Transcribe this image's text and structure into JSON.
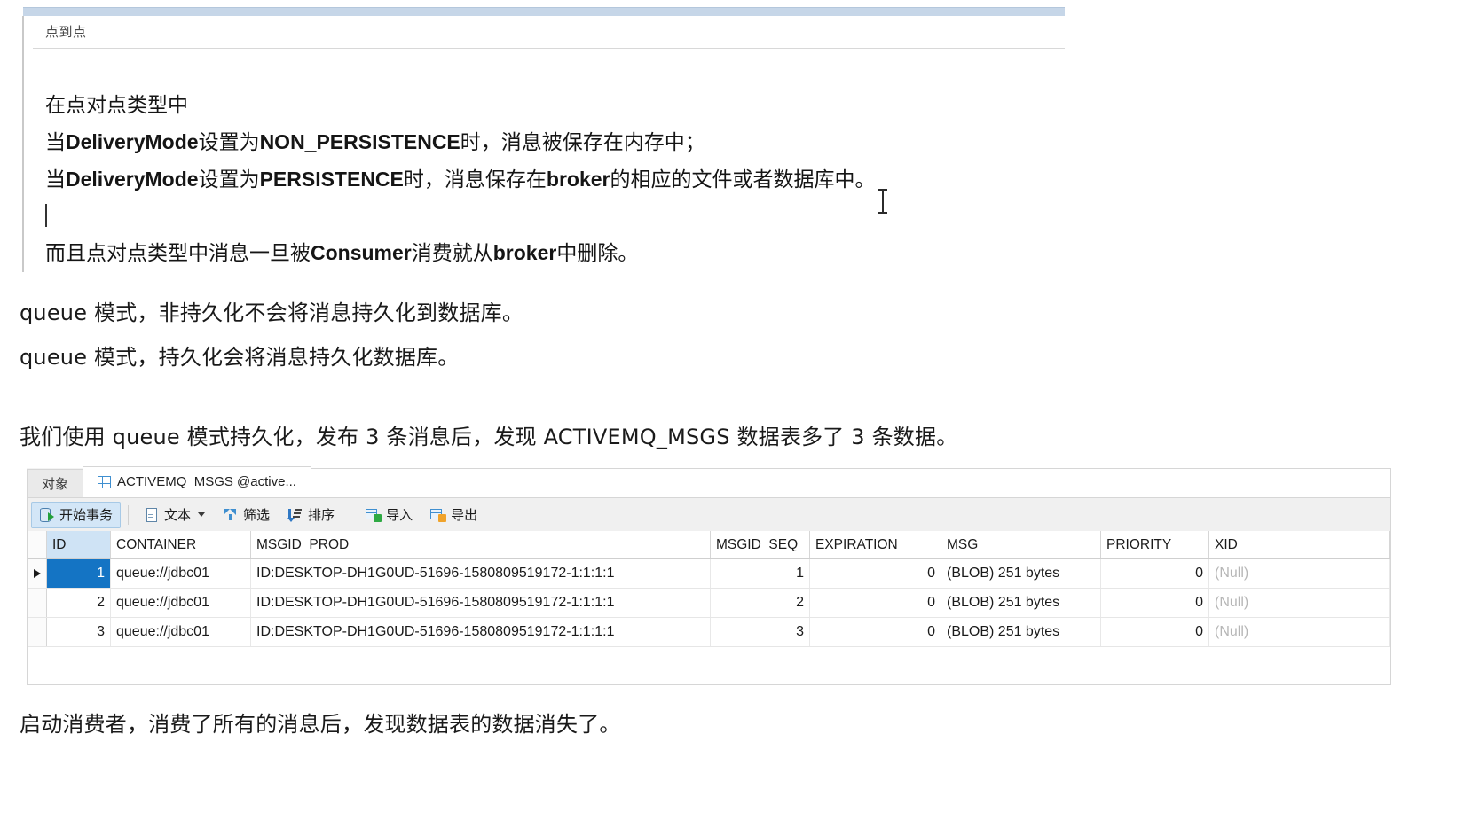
{
  "note": {
    "header_title": "点到点",
    "lines": [
      {
        "id": "l1",
        "text": "在点对点类型中"
      },
      {
        "id": "l2",
        "text": "当DeliveryMode设置为NON_PERSISTENCE时，消息被保存在内存中；"
      },
      {
        "id": "l3",
        "text": "当DeliveryMode设置为PERSISTENCE时，消息保存在broker的相应的文件或者数据库中。"
      },
      {
        "id": "l4",
        "text": ""
      },
      {
        "id": "l5",
        "text": "而且点对点类型中消息一旦被Consumer消费就从broker中删除。"
      }
    ]
  },
  "body": {
    "para1": "queue 模式，非持久化不会将消息持久化到数据库。",
    "para2": "queue 模式，持久化会将消息持久化数据库。",
    "para3": "我们使用 queue 模式持久化，发布 3 条消息后，发现 ACTIVEMQ_MSGS 数据表多了 3 条数据。",
    "para4": "启动消费者，消费了所有的消息后，发现数据表的数据消失了。"
  },
  "db": {
    "tabs": [
      {
        "label": "对象",
        "active": false,
        "icon": ""
      },
      {
        "label": "ACTIVEMQ_MSGS @active...",
        "active": true,
        "icon": "grid-icon"
      }
    ],
    "toolbar": [
      {
        "label": "开始事务",
        "icon": "transaction-icon",
        "pressed": true,
        "caret": false
      },
      {
        "label": "文本",
        "icon": "document-icon",
        "pressed": false,
        "caret": true
      },
      {
        "label": "筛选",
        "icon": "funnel-icon",
        "pressed": false,
        "caret": false
      },
      {
        "label": "排序",
        "icon": "sort-icon",
        "pressed": false,
        "caret": false
      },
      {
        "label": "导入",
        "icon": "import-icon",
        "pressed": false,
        "caret": false
      },
      {
        "label": "导出",
        "icon": "export-icon",
        "pressed": false,
        "caret": false
      }
    ],
    "columns": [
      "ID",
      "CONTAINER",
      "MSGID_PROD",
      "MSGID_SEQ",
      "EXPIRATION",
      "MSG",
      "PRIORITY",
      "XID"
    ],
    "rows": [
      {
        "id": "1",
        "container": "queue://jdbc01",
        "msgid_prod": "ID:DESKTOP-DH1G0UD-51696-1580809519172-1:1:1:1",
        "msgid_seq": "1",
        "expiration": "0",
        "msg": "(BLOB) 251 bytes",
        "priority": "0",
        "xid": "(Null)",
        "selected": true
      },
      {
        "id": "2",
        "container": "queue://jdbc01",
        "msgid_prod": "ID:DESKTOP-DH1G0UD-51696-1580809519172-1:1:1:1",
        "msgid_seq": "2",
        "expiration": "0",
        "msg": "(BLOB) 251 bytes",
        "priority": "0",
        "xid": "(Null)",
        "selected": false
      },
      {
        "id": "3",
        "container": "queue://jdbc01",
        "msgid_prod": "ID:DESKTOP-DH1G0UD-51696-1580809519172-1:1:1:1",
        "msgid_seq": "3",
        "expiration": "0",
        "msg": "(BLOB) 251 bytes",
        "priority": "0",
        "xid": "(Null)",
        "selected": false
      }
    ]
  },
  "colors": {
    "note_topbar": "#c6d6e8",
    "selection_blue": "#1474c4",
    "toolbar_pressed": "#d3e6f7",
    "null_grey": "#b6b6b6",
    "header_id_highlight": "#cfe3f5"
  }
}
